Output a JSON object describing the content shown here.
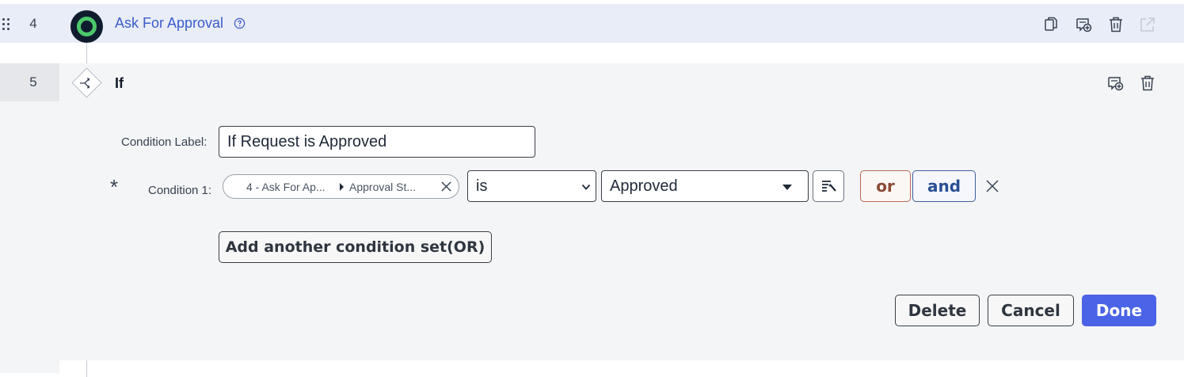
{
  "step4": {
    "number": "4",
    "title": "Ask For Approval",
    "icons": [
      "drag-handle-icon",
      "help-icon",
      "copy-icon",
      "add-comment-icon",
      "trash-icon",
      "open-external-icon"
    ]
  },
  "step5": {
    "number": "5",
    "title": "If",
    "icons": [
      "branch-icon",
      "add-comment-icon",
      "trash-icon"
    ]
  },
  "condition_label": {
    "label": "Condition Label:",
    "value": "If Request is Approved"
  },
  "condition1": {
    "required_mark": "*",
    "label": "Condition 1:",
    "pill_step": "4 - Ask For Ap...",
    "pill_field": "Approval St...",
    "operator": "is",
    "value": "Approved",
    "or_label": "or",
    "and_label": "and"
  },
  "add_condition_set_label": "Add another condition set(OR)",
  "footer": {
    "delete_label": "Delete",
    "cancel_label": "Cancel",
    "done_label": "Done"
  },
  "colors": {
    "accent": "#4b63e6",
    "link": "#3b5bcc",
    "or": "#8b4a36",
    "and": "#2a4f93",
    "approval_ring": "#4cc86b"
  }
}
